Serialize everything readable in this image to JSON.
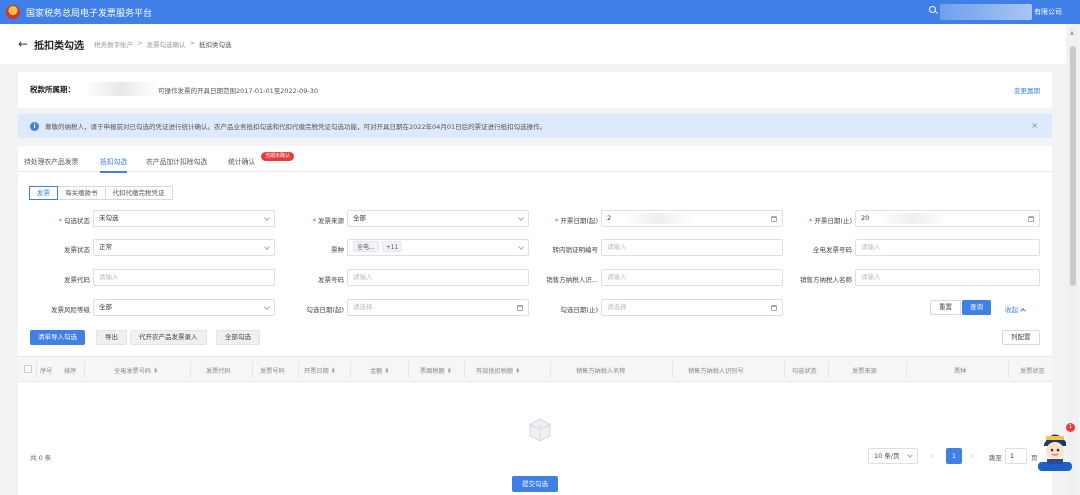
{
  "app": {
    "title": "国家税务总局电子发票服务平台",
    "user_name_suffix": "有限公司"
  },
  "page": {
    "title": "抵扣类勾选",
    "breadcrumb": [
      "税务数字账户",
      "发票勾选确认",
      "抵扣类勾选"
    ]
  },
  "period": {
    "label": "税款所属期：",
    "text": "可操作发票的开具日期范围2017-01-01至2022-09-30",
    "change_link": "变更属期"
  },
  "notice": {
    "text": "尊敬的纳税人，请于申报前对已勾选的凭证进行统计确认。农产品业务抵扣勾选和代扣代缴完税凭证勾选功能，可对开具日期在2022年04月01日后的票证进行抵扣勾选操作。"
  },
  "tabs": [
    {
      "label": "待处理农产品发票",
      "active": false
    },
    {
      "label": "抵扣勾选",
      "active": true
    },
    {
      "label": "农产品加计扣除勾选",
      "active": false
    },
    {
      "label": "统计确认",
      "active": false
    }
  ],
  "tab_badge": "当期未确认",
  "subtabs": [
    {
      "label": "发票",
      "active": true
    },
    {
      "label": "海关缴款书",
      "active": false
    },
    {
      "label": "代扣代缴完税凭证",
      "active": false
    }
  ],
  "filters": {
    "check_status": {
      "label": "勾选状态",
      "value": "未勾选"
    },
    "invoice_source": {
      "label": "发票来源",
      "value": "全部"
    },
    "issue_date_start": {
      "label": "开票日期(起)",
      "value": "2"
    },
    "issue_date_end": {
      "label": "开票日期(止)",
      "value": "20"
    },
    "invoice_status": {
      "label": "发票状态",
      "value": "正常"
    },
    "ticket_type": {
      "label": "票种",
      "tag": "全电...",
      "more": "+11"
    },
    "transfer_cert_no": {
      "label": "转内销证明编号",
      "placeholder": "请输入"
    },
    "full_invoice_no": {
      "label": "全电发票号码",
      "placeholder": "请输入"
    },
    "invoice_code": {
      "label": "发票代码",
      "placeholder": "请输入"
    },
    "invoice_no": {
      "label": "发票号码",
      "placeholder": "请输入"
    },
    "seller_tax_id": {
      "label": "销售方纳税人识...",
      "placeholder": "请输入"
    },
    "seller_name": {
      "label": "销售方纳税人名称",
      "placeholder": "请输入"
    },
    "risk_level": {
      "label": "发票风险等级",
      "value": "全部"
    },
    "check_date_start": {
      "label": "勾选日期(起)",
      "placeholder": "请选择"
    },
    "check_date_end": {
      "label": "勾选日期(止)",
      "placeholder": "请选择"
    }
  },
  "actions": {
    "reset": "重置",
    "query": "查询",
    "collapse": "收起",
    "bulk_import": "清单导入勾选",
    "export": "导出",
    "farm_entry": "代开农产品发票录入",
    "select_all": "全部勾选",
    "column_config": "列配置"
  },
  "table": {
    "columns": [
      {
        "label": "序号",
        "sortable": false
      },
      {
        "label": "排序",
        "sortable": false
      },
      {
        "label": "全电发票号码",
        "sortable": true
      },
      {
        "label": "发票代码",
        "sortable": false
      },
      {
        "label": "发票号码",
        "sortable": false
      },
      {
        "label": "开票日期",
        "sortable": true
      },
      {
        "label": "金额",
        "sortable": true
      },
      {
        "label": "票面税额",
        "sortable": true
      },
      {
        "label": "有效抵扣税额",
        "sortable": true
      },
      {
        "label": "销售方纳税人名称",
        "sortable": false
      },
      {
        "label": "销售方纳税人识别号",
        "sortable": false
      },
      {
        "label": "勾选状态",
        "sortable": false
      },
      {
        "label": "发票来源",
        "sortable": false
      },
      {
        "label": "票种",
        "sortable": false
      },
      {
        "label": "发票状态",
        "sortable": false
      }
    ],
    "rows": []
  },
  "pagination": {
    "total": "共 0 条",
    "page_size": "10 条/页",
    "current_page": "1",
    "goto_label": "跳至",
    "goto_value": "1",
    "goto_unit": "页"
  },
  "submit": "提交勾选",
  "mascot_badge": "1",
  "colors": {
    "primary": "#3f7fe6",
    "danger": "#e83b3b",
    "notice_bg": "#dceafb"
  }
}
